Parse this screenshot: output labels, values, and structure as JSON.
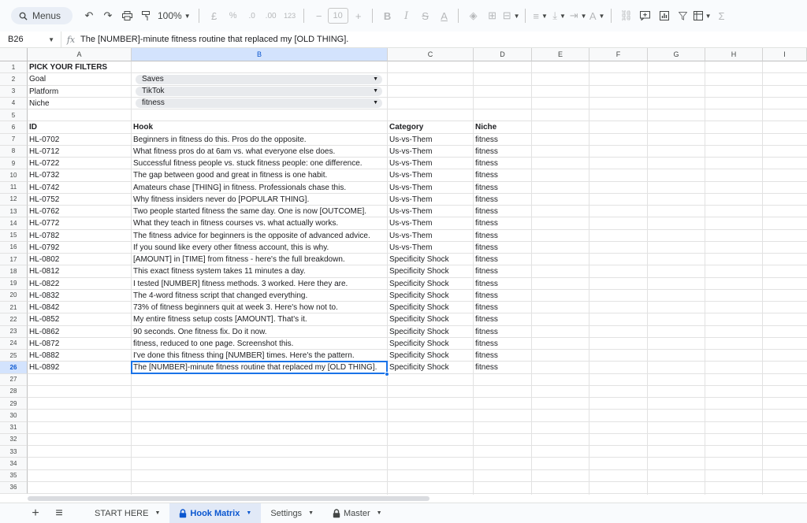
{
  "toolbar": {
    "menus_label": "Menus",
    "zoom": "100%",
    "currency": "£",
    "percent": "%",
    "dec_dec": ".0",
    "dec_inc": ".00",
    "number_format": "123",
    "font_size": "10",
    "bold": "B",
    "italic": "I",
    "strike": "S",
    "text_color": "A",
    "text_rotate": "A",
    "sum": "Σ"
  },
  "formula_bar": {
    "cell_ref": "B26",
    "fx": "fx",
    "value": "The [NUMBER]-minute fitness routine that replaced my [OLD THING]."
  },
  "columns": [
    "A",
    "B",
    "C",
    "D",
    "E",
    "F",
    "G",
    "H",
    "I"
  ],
  "rows": [
    "1",
    "2",
    "3",
    "4",
    "5",
    "6",
    "7",
    "8",
    "9",
    "10",
    "11",
    "12",
    "13",
    "14",
    "15",
    "16",
    "17",
    "18",
    "19",
    "20",
    "21",
    "22",
    "23",
    "24",
    "25",
    "26",
    "27",
    "28",
    "29",
    "30",
    "31",
    "32",
    "33",
    "34",
    "35",
    "36"
  ],
  "filters": {
    "title": "PICK YOUR FILTERS",
    "goal_label": "Goal",
    "goal_value": "Saves",
    "platform_label": "Platform",
    "platform_value": "TikTok",
    "niche_label": "Niche",
    "niche_value": "fitness"
  },
  "table": {
    "headers": [
      "ID",
      "Hook",
      "Category",
      "Niche"
    ],
    "rows": [
      [
        "HL-0702",
        "Beginners in fitness do this. Pros do the opposite.",
        "Us-vs-Them",
        "fitness"
      ],
      [
        "HL-0712",
        "What fitness pros do at 6am vs. what everyone else does.",
        "Us-vs-Them",
        "fitness"
      ],
      [
        "HL-0722",
        "Successful fitness people vs. stuck fitness people: one difference.",
        "Us-vs-Them",
        "fitness"
      ],
      [
        "HL-0732",
        "The gap between good and great in fitness is one habit.",
        "Us-vs-Them",
        "fitness"
      ],
      [
        "HL-0742",
        "Amateurs chase [THING] in fitness. Professionals chase this.",
        "Us-vs-Them",
        "fitness"
      ],
      [
        "HL-0752",
        "Why fitness insiders never do [POPULAR THING].",
        "Us-vs-Them",
        "fitness"
      ],
      [
        "HL-0762",
        "Two people started fitness the same day. One is now [OUTCOME].",
        "Us-vs-Them",
        "fitness"
      ],
      [
        "HL-0772",
        "What they teach in fitness courses vs. what actually works.",
        "Us-vs-Them",
        "fitness"
      ],
      [
        "HL-0782",
        "The fitness advice for beginners is the opposite of advanced advice.",
        "Us-vs-Them",
        "fitness"
      ],
      [
        "HL-0792",
        "If you sound like every other fitness account, this is why.",
        "Us-vs-Them",
        "fitness"
      ],
      [
        "HL-0802",
        "[AMOUNT] in [TIME] from fitness - here's the full breakdown.",
        "Specificity Shock",
        "fitness"
      ],
      [
        "HL-0812",
        "This exact fitness system takes 11 minutes a day.",
        "Specificity Shock",
        "fitness"
      ],
      [
        "HL-0822",
        "I tested [NUMBER] fitness methods. 3 worked. Here they are.",
        "Specificity Shock",
        "fitness"
      ],
      [
        "HL-0832",
        "The 4-word fitness script that changed everything.",
        "Specificity Shock",
        "fitness"
      ],
      [
        "HL-0842",
        "73% of fitness beginners quit at week 3. Here's how not to.",
        "Specificity Shock",
        "fitness"
      ],
      [
        "HL-0852",
        "My entire fitness setup costs [AMOUNT]. That's it.",
        "Specificity Shock",
        "fitness"
      ],
      [
        "HL-0862",
        "90 seconds. One fitness fix. Do it now.",
        "Specificity Shock",
        "fitness"
      ],
      [
        "HL-0872",
        "fitness, reduced to one page. Screenshot this.",
        "Specificity Shock",
        "fitness"
      ],
      [
        "HL-0882",
        "I've done this fitness thing [NUMBER] times. Here's the pattern.",
        "Specificity Shock",
        "fitness"
      ],
      [
        "HL-0892",
        "The [NUMBER]-minute fitness routine that replaced my [OLD THING].",
        "Specificity Shock",
        "fitness"
      ]
    ]
  },
  "sheet_tabs": {
    "tabs": [
      "START HERE",
      "Hook Matrix",
      "Settings",
      "Master"
    ],
    "active": "Hook Matrix"
  },
  "colors": {
    "accent": "#1a73e8",
    "selected_header": "#d3e3fd",
    "active_tab": "#0b57d0"
  }
}
